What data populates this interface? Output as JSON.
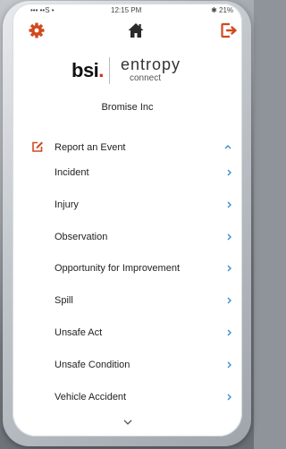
{
  "status_bar": {
    "carrier": "••• ••S •",
    "time": "12:15 PM",
    "battery": "✱ 21%"
  },
  "nav": {
    "settings_icon": "gear-icon",
    "home_icon": "home-icon",
    "logout_icon": "logout-icon",
    "accent_color": "#d04a1e"
  },
  "brand": {
    "bsi": "bsi",
    "bsi_dot": ".",
    "entropy": "entropy",
    "connect": "connect",
    "bsi_red": "#d62b1e"
  },
  "organization": "Bromise Inc",
  "section": {
    "title": "Report an Event",
    "icon": "edit-icon",
    "expanded": true
  },
  "events": [
    {
      "label": "Incident"
    },
    {
      "label": "Injury"
    },
    {
      "label": "Observation"
    },
    {
      "label": "Opportunity for Improvement"
    },
    {
      "label": "Spill"
    },
    {
      "label": "Unsafe Act"
    },
    {
      "label": "Unsafe Condition"
    },
    {
      "label": "Vehicle Accident"
    }
  ],
  "chevron_color": "#3a8fd0"
}
